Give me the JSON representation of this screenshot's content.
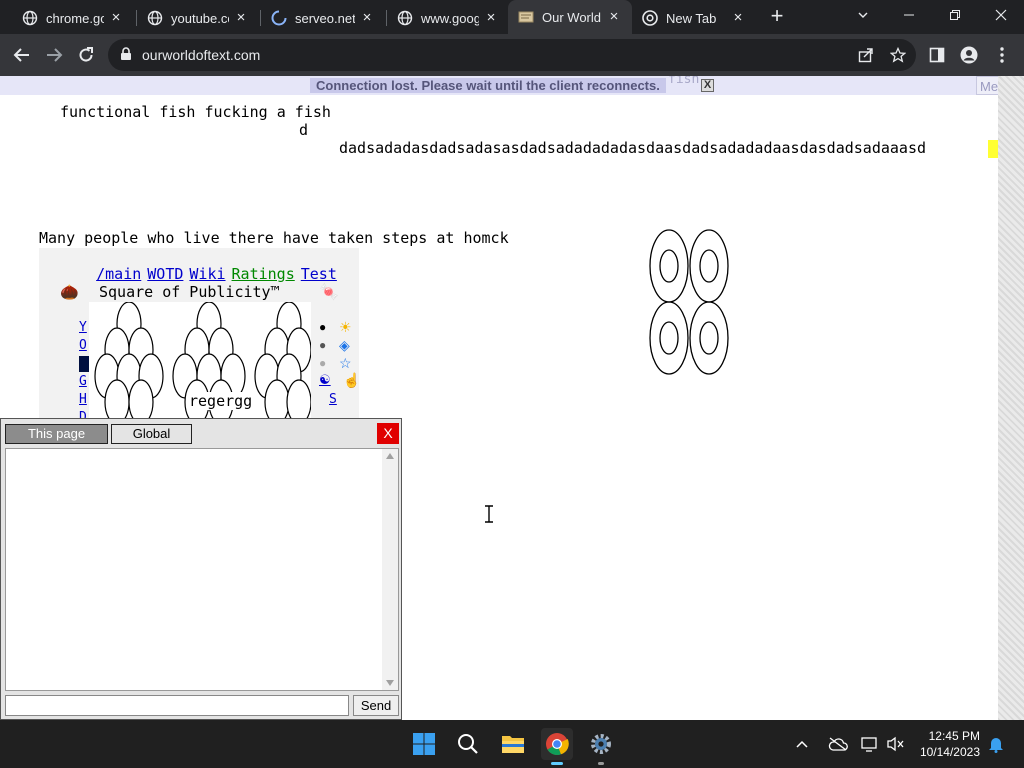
{
  "browser": {
    "tabs": [
      {
        "title": "chrome.goo",
        "favicon": "globe-icon",
        "active": false
      },
      {
        "title": "youtube.co",
        "favicon": "globe-icon",
        "active": false
      },
      {
        "title": "serveo.net:",
        "favicon": "loading-spinner-icon",
        "active": false
      },
      {
        "title": "www.googl",
        "favicon": "globe-icon",
        "active": false
      },
      {
        "title": "Our World",
        "favicon": "owot-favicon-icon",
        "active": true
      },
      {
        "title": "New Tab",
        "favicon": "chrome-icon",
        "active": false
      }
    ],
    "close_glyph": "×",
    "new_tab_glyph": "+",
    "url": "ourworldoftext.com"
  },
  "page": {
    "banner": {
      "message": "Connection lost. Please wait until the client reconnects.",
      "close_label": "X",
      "menu_label": "Menu",
      "ghost_text": "fish,"
    },
    "text_lines": [
      "functional fish fucking a fish",
      "d",
      "dadsadadasdadsadasasdadsadadadadasdaasdadsadadadaasdasdadsadaaasd",
      "Many people who live there have taken steps at homck"
    ],
    "links": [
      {
        "label": "/main",
        "color": "#0000cc"
      },
      {
        "label": "WOTD",
        "color": "#0000cc"
      },
      {
        "label": "Wiki",
        "color": "#0000cc"
      },
      {
        "label": "Ratings",
        "color": "#008800"
      },
      {
        "label": "Test",
        "color": "#0000cc"
      }
    ],
    "square_title": "Square of Publicity™",
    "left_letters": [
      "Y",
      "O",
      "",
      "G",
      "H",
      "D"
    ],
    "art_label": "regergg",
    "right_glyphs": [
      "●",
      "●",
      "●",
      "☯",
      "S"
    ],
    "right_icons": [
      "☀",
      "◈",
      "☆",
      "☝"
    ]
  },
  "chat": {
    "tab_this_page": "This page",
    "tab_global": "Global",
    "close_label": "X",
    "input_value": "",
    "send_label": "Send"
  },
  "taskbar": {
    "time": "12:45 PM",
    "date": "10/14/2023"
  },
  "colors": {
    "tab_bar": "#202124",
    "toolbar": "#35363a",
    "banner": "#e6e6f8",
    "highlight": "#ffff33",
    "chat_close": "#e00000",
    "taskbar": "#202020"
  }
}
